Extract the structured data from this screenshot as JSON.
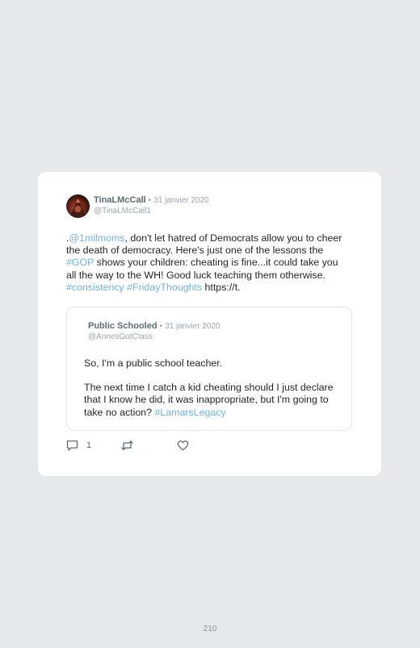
{
  "tweet": {
    "author_name": "TinaLMcCall",
    "separator": "•",
    "date": "31 janvier 2020",
    "handle": "@TinaLMcCall1",
    "text": {
      "prefix": ".",
      "mention": "@1milmoms",
      "part1": ", don't let hatred of Democrats allow you to cheer the death of democracy. Here's just one of the lessons the ",
      "hashtag_gop": "#GOP",
      "part2": " shows your children: cheating is fine...it could take you all the way to the WH! Good luck teaching them otherwise. ",
      "hashtag_consistency": "#consistency",
      "space": " ",
      "hashtag_friday": "#FridayThoughts",
      "url": " https://t."
    },
    "quoted": {
      "author_name": "Public Schooled",
      "separator": "•",
      "date": "31 janvier 2020",
      "handle": "@AnnesGotClass",
      "paragraph1": "So, I'm a public school teacher.",
      "paragraph2": "The next time I catch a kid cheating should I just declare that I know he did, it was inappropriate, but I'm going to take no action? ",
      "hashtag": "#LamarsLegacy"
    },
    "actions": {
      "reply_icon": "comment-icon",
      "reply_count": "1",
      "retweet_icon": "retweet-icon",
      "like_icon": "heart-icon"
    }
  },
  "colors": {
    "background": "#e5e9ec",
    "card": "#ffffff",
    "link": "#6cb3e6",
    "muted": "#9aa5ad",
    "name": "#5b6b78"
  },
  "page": {
    "number": "210"
  }
}
